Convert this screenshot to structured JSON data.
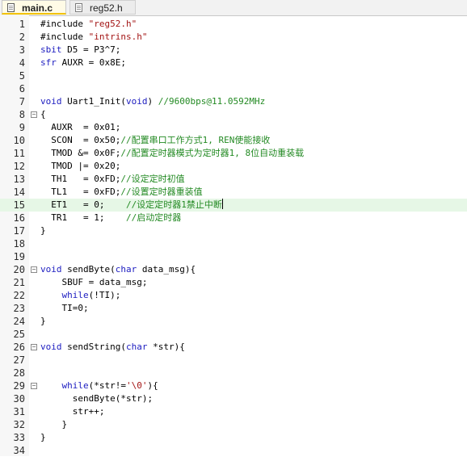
{
  "tabs": [
    {
      "label": "main.c",
      "active": true
    },
    {
      "label": "reg52.h",
      "active": false
    }
  ],
  "lines": [
    {
      "n": "1",
      "t": [
        [
          "pp",
          "#include "
        ],
        [
          "str",
          "\"reg52.h\""
        ]
      ]
    },
    {
      "n": "2",
      "t": [
        [
          "pp",
          "#include "
        ],
        [
          "str",
          "\"intrins.h\""
        ]
      ]
    },
    {
      "n": "3",
      "t": [
        [
          "kw",
          "sbit"
        ],
        [
          "pl",
          " D5 = P3^7;"
        ]
      ]
    },
    {
      "n": "4",
      "t": [
        [
          "kw",
          "sfr"
        ],
        [
          "pl",
          " AUXR = 0x8E;"
        ]
      ]
    },
    {
      "n": "5",
      "t": []
    },
    {
      "n": "6",
      "t": []
    },
    {
      "n": "7",
      "t": [
        [
          "kw",
          "void"
        ],
        [
          "pl",
          " Uart1_Init("
        ],
        [
          "kw",
          "void"
        ],
        [
          "pl",
          ") "
        ],
        [
          "cm",
          "//9600bps@11.0592MHz"
        ]
      ]
    },
    {
      "n": "8",
      "fold": true,
      "t": [
        [
          "pl",
          "{"
        ]
      ]
    },
    {
      "n": "9",
      "t": [
        [
          "pl",
          "  AUXR  = 0x01;"
        ]
      ]
    },
    {
      "n": "10",
      "t": [
        [
          "pl",
          "  SCON  = 0x50;"
        ],
        [
          "cm",
          "//配置串口工作方式1, REN使能接收"
        ]
      ]
    },
    {
      "n": "11",
      "t": [
        [
          "pl",
          "  TMOD &= 0x0F;"
        ],
        [
          "cm",
          "//配置定时器模式为定时器1, 8位自动重装载"
        ]
      ]
    },
    {
      "n": "12",
      "t": [
        [
          "pl",
          "  TMOD |= 0x20;"
        ]
      ]
    },
    {
      "n": "13",
      "t": [
        [
          "pl",
          "  TH1   = 0xFD;"
        ],
        [
          "cm",
          "//设定定时初值"
        ]
      ]
    },
    {
      "n": "14",
      "t": [
        [
          "pl",
          "  TL1   = 0xFD;"
        ],
        [
          "cm",
          "//设置定时器重装值"
        ]
      ]
    },
    {
      "n": "15",
      "hl": true,
      "caret": true,
      "t": [
        [
          "pl",
          "  ET1   = 0;    "
        ],
        [
          "cm",
          "//设定定时器1禁止中断"
        ]
      ]
    },
    {
      "n": "16",
      "t": [
        [
          "pl",
          "  TR1   = 1;    "
        ],
        [
          "cm",
          "//启动定时器"
        ]
      ]
    },
    {
      "n": "17",
      "t": [
        [
          "pl",
          "}"
        ]
      ]
    },
    {
      "n": "18",
      "t": []
    },
    {
      "n": "19",
      "t": []
    },
    {
      "n": "20",
      "fold": true,
      "t": [
        [
          "kw",
          "void"
        ],
        [
          "pl",
          " sendByte("
        ],
        [
          "kw",
          "char"
        ],
        [
          "pl",
          " data_msg){"
        ]
      ]
    },
    {
      "n": "21",
      "t": [
        [
          "pl",
          "    SBUF = data_msg;"
        ]
      ]
    },
    {
      "n": "22",
      "t": [
        [
          "pl",
          "    "
        ],
        [
          "kw",
          "while"
        ],
        [
          "pl",
          "(!TI);"
        ]
      ]
    },
    {
      "n": "23",
      "t": [
        [
          "pl",
          "    TI=0;"
        ]
      ]
    },
    {
      "n": "24",
      "t": [
        [
          "pl",
          "}"
        ]
      ]
    },
    {
      "n": "25",
      "t": []
    },
    {
      "n": "26",
      "fold": true,
      "t": [
        [
          "kw",
          "void"
        ],
        [
          "pl",
          " sendString("
        ],
        [
          "kw",
          "char"
        ],
        [
          "pl",
          " *str){"
        ]
      ]
    },
    {
      "n": "27",
      "t": []
    },
    {
      "n": "28",
      "t": []
    },
    {
      "n": "29",
      "fold": true,
      "t": [
        [
          "pl",
          "    "
        ],
        [
          "kw",
          "while"
        ],
        [
          "pl",
          "(*str!="
        ],
        [
          "str",
          "'\\0'"
        ],
        [
          "pl",
          "){"
        ]
      ]
    },
    {
      "n": "30",
      "t": [
        [
          "pl",
          "      sendByte(*str);"
        ]
      ]
    },
    {
      "n": "31",
      "t": [
        [
          "pl",
          "      str++;"
        ]
      ]
    },
    {
      "n": "32",
      "t": [
        [
          "pl",
          "    }"
        ]
      ]
    },
    {
      "n": "33",
      "t": [
        [
          "pl",
          "}"
        ]
      ]
    },
    {
      "n": "34",
      "t": []
    }
  ],
  "colors": {
    "keyword": "#1c1cc0",
    "string": "#a31515",
    "comment": "#238a23",
    "highlight": "#e6f7e6"
  }
}
